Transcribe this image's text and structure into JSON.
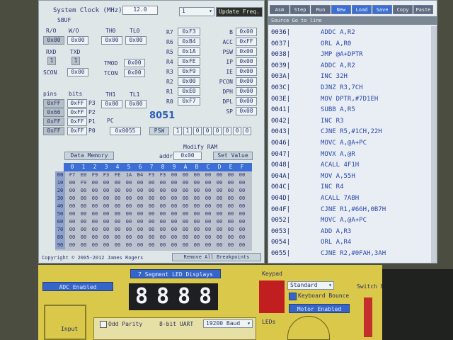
{
  "sim": {
    "system_clock_label": "System Clock (MHz)",
    "system_clock_value": "12.0",
    "freq_select": "1",
    "update_freq_label": "Update Freq.",
    "sbuf_label": "SBUF",
    "ro_label": "R/O",
    "wo_label": "W/O",
    "ro_value": "0x00",
    "wo_value": "0x00",
    "rxd_label": "RXD",
    "txd_label": "TXD",
    "rxd_value": "1",
    "txd_value": "1",
    "scon_label": "SCON",
    "scon_value": "0x00",
    "th0_label": "TH0",
    "tl0_label": "TL0",
    "th0_value": "0x00",
    "tl0_value": "0x00",
    "tmod_label": "TMOD",
    "tmod_value": "0x00",
    "tcon_label": "TCON",
    "tcon_value": "0x00",
    "th1_label": "TH1",
    "tl1_label": "TL1",
    "th1_value": "0x00",
    "tl1_value": "0x00",
    "pins_label": "pins",
    "bits_label": "bits",
    "ports": [
      {
        "pins": "0xFF",
        "bits": "0xFF",
        "name": "P3"
      },
      {
        "pins": "0x66",
        "bits": "0xFF",
        "name": "P2"
      },
      {
        "pins": "0xFF",
        "bits": "0xFF",
        "name": "P1"
      },
      {
        "pins": "0xFF",
        "bits": "0xFF",
        "name": "P0"
      }
    ],
    "regs": [
      {
        "name": "R7",
        "value": "0xF3"
      },
      {
        "name": "R6",
        "value": "0xB4"
      },
      {
        "name": "R5",
        "value": "0x1A"
      },
      {
        "name": "R4",
        "value": "0xFE"
      },
      {
        "name": "R3",
        "value": "0xF9"
      },
      {
        "name": "R2",
        "value": "0x00"
      },
      {
        "name": "R1",
        "value": "0xE0"
      },
      {
        "name": "R0",
        "value": "0xF7"
      }
    ],
    "sfrs": [
      {
        "name": "B",
        "value": "0x00"
      },
      {
        "name": "ACC",
        "value": "0xFF"
      },
      {
        "name": "PSW",
        "value": "0x00"
      },
      {
        "name": "IP",
        "value": "0x00"
      },
      {
        "name": "IE",
        "value": "0x00"
      },
      {
        "name": "PCON",
        "value": "0x00"
      },
      {
        "name": "DPH",
        "value": "0x00"
      },
      {
        "name": "DPL",
        "value": "0x00"
      },
      {
        "name": "SP",
        "value": "0x08"
      }
    ],
    "title_8051": "8051",
    "pc_label": "PC",
    "pc_value": "0x0055",
    "psw_label": "PSW",
    "psw_bits": [
      "1",
      "1",
      "0",
      "0",
      "0",
      "0",
      "0",
      "0"
    ],
    "modify_ram_label": "Modify RAM",
    "data_memory_label": "Data Memory",
    "addr_label": "addr",
    "addr_value": "0x00",
    "set_value_label": "Set Value",
    "mem_cols": [
      "0",
      "1",
      "2",
      "3",
      "4",
      "5",
      "6",
      "7",
      "8",
      "9",
      "A",
      "B",
      "C",
      "D",
      "E",
      "F"
    ],
    "mem_rows": [
      {
        "label": "00",
        "cells": [
          "F7",
          "E0",
          "F9",
          "F3",
          "FE",
          "1A",
          "B4",
          "F3",
          "F3",
          "00",
          "00",
          "00",
          "00",
          "00",
          "00",
          "00"
        ]
      },
      {
        "label": "10",
        "cells": [
          "00",
          "F9",
          "00",
          "00",
          "00",
          "00",
          "00",
          "00",
          "00",
          "00",
          "00",
          "00",
          "00",
          "00",
          "00",
          "00"
        ]
      },
      {
        "label": "20",
        "cells": [
          "00",
          "00",
          "00",
          "00",
          "00",
          "00",
          "00",
          "00",
          "00",
          "00",
          "00",
          "00",
          "00",
          "00",
          "00",
          "00"
        ]
      },
      {
        "label": "30",
        "cells": [
          "00",
          "00",
          "00",
          "00",
          "00",
          "00",
          "00",
          "00",
          "00",
          "00",
          "00",
          "00",
          "00",
          "00",
          "00",
          "00"
        ]
      },
      {
        "label": "40",
        "cells": [
          "00",
          "00",
          "00",
          "00",
          "00",
          "00",
          "00",
          "00",
          "00",
          "00",
          "00",
          "00",
          "00",
          "00",
          "00",
          "00"
        ]
      },
      {
        "label": "50",
        "cells": [
          "00",
          "00",
          "00",
          "00",
          "00",
          "00",
          "00",
          "00",
          "00",
          "00",
          "00",
          "00",
          "00",
          "00",
          "00",
          "00"
        ]
      },
      {
        "label": "60",
        "cells": [
          "00",
          "00",
          "00",
          "00",
          "00",
          "00",
          "00",
          "00",
          "00",
          "00",
          "00",
          "00",
          "00",
          "00",
          "00",
          "00"
        ]
      },
      {
        "label": "70",
        "cells": [
          "00",
          "00",
          "00",
          "00",
          "00",
          "00",
          "00",
          "00",
          "00",
          "00",
          "00",
          "00",
          "00",
          "00",
          "00",
          "00"
        ]
      },
      {
        "label": "80",
        "cells": [
          "00",
          "00",
          "00",
          "00",
          "00",
          "00",
          "00",
          "00",
          "00",
          "00",
          "00",
          "00",
          "00",
          "00",
          "00",
          "00"
        ]
      },
      {
        "label": "90",
        "cells": [
          "00",
          "00",
          "00",
          "00",
          "00",
          "00",
          "00",
          "00",
          "00",
          "00",
          "00",
          "00",
          "00",
          "00",
          "00",
          "00"
        ]
      }
    ],
    "copyright": "Copyright © 2005-2012 James Rogers",
    "reset_label": "Remove All Breakpoints"
  },
  "code": {
    "toolbar": [
      "Asm",
      "Step",
      "Run",
      "New",
      "Load",
      "Save",
      "Copy",
      "Paste"
    ],
    "sub_toolbar": "Source   Go to line",
    "lines": [
      {
        "addr": "0036|",
        "instr": "ADDC A,R2"
      },
      {
        "addr": "0037|",
        "instr": "ORL A,R0"
      },
      {
        "addr": "0038|",
        "instr": "JMP @A+DPTR"
      },
      {
        "addr": "0039|",
        "instr": "ADDC A,R2"
      },
      {
        "addr": "003A|",
        "instr": "INC 32H"
      },
      {
        "addr": "003C|",
        "instr": "DJNZ R3,7CH"
      },
      {
        "addr": "003E|",
        "instr": "MOV DPTR,#7D1EH"
      },
      {
        "addr": "0041|",
        "instr": "SUBB A,R5"
      },
      {
        "addr": "0042|",
        "instr": "INC R3"
      },
      {
        "addr": "0043|",
        "instr": "CJNE R5,#1CH,22H"
      },
      {
        "addr": "0046|",
        "instr": "MOVC A,@A+PC"
      },
      {
        "addr": "0047|",
        "instr": "MOVX A,@R"
      },
      {
        "addr": "0048|",
        "instr": "ACALL 4F1H"
      },
      {
        "addr": "004A|",
        "instr": "MOV A,55H"
      },
      {
        "addr": "004C|",
        "instr": "INC R4"
      },
      {
        "addr": "004D|",
        "instr": "ACALL 7ABH"
      },
      {
        "addr": "004F|",
        "instr": "CJNE R1,#66H,0B7H"
      },
      {
        "addr": "0052|",
        "instr": "MOVC A,@A+PC"
      },
      {
        "addr": "0053|",
        "instr": "ADD A,R3"
      },
      {
        "addr": "0054|",
        "instr": "ORL A,R4"
      },
      {
        "addr": "0055|",
        "instr": "CJNE R2,#0FAH,3AH"
      }
    ]
  },
  "bottom": {
    "adc_label": "ADC Enabled",
    "seg_label": "7 Segment LED Displays",
    "seg_digits": [
      "8",
      "8",
      "8",
      "8"
    ],
    "keypad_label": "Keypad",
    "standard_select": "Standard",
    "keyboard_bounce_label": "Keyboard Bounce",
    "motor_label": "Motor Enabled",
    "switch_bank_label": "Switch Bank",
    "input_label": "Input",
    "odd_parity_label": "Odd Parity",
    "uart_label": "8-bit UART",
    "baud_label": "19200 Baud",
    "leds_label": "LEDs"
  },
  "colors": {
    "accent": "#3b6fd6",
    "yellow_panel": "#d9c84a",
    "seg_bg": "#1e1f22",
    "led_red": "#c01e20"
  }
}
